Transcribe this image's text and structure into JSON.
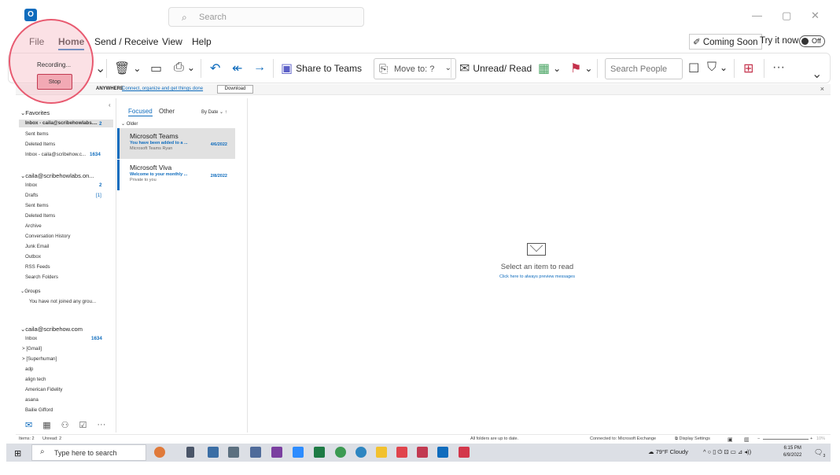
{
  "titlebar": {
    "logo": "O",
    "search_placeholder": "Search",
    "controls": [
      "—",
      "▢",
      "✕"
    ]
  },
  "menu": {
    "tabs": [
      "File",
      "Home",
      "Send / Receive",
      "View",
      "Help"
    ],
    "active": "Home",
    "coming_soon": "Coming Soon",
    "try_it_now": "Try it now",
    "toggle_state": "Off"
  },
  "ribbon": {
    "share_to_teams": "Share to Teams",
    "move_to": "Move to: ?",
    "unread_read": "Unread/ Read",
    "search_people_placeholder": "Search People",
    "more": "···"
  },
  "infobar": {
    "lead": "ANYWHERE",
    "link": "Connect, organize and get things done",
    "download": "Download",
    "close": "×"
  },
  "recording": {
    "status": "Recording...",
    "stop": "Stop"
  },
  "folders": {
    "favorites_header": "Favorites",
    "favorites": [
      {
        "label": "Inbox - caila@scribehowlabs....",
        "count": "2"
      },
      {
        "label": "Sent Items",
        "count": ""
      },
      {
        "label": "Deleted Items",
        "count": ""
      },
      {
        "label": "Inbox - caila@scribehow.c...",
        "count": "1634"
      }
    ],
    "account1_header": "caila@scribehowlabs.on...",
    "account1": [
      {
        "label": "Inbox",
        "count": "2"
      },
      {
        "label": "Drafts",
        "count": "[1]"
      },
      {
        "label": "Sent Items",
        "count": ""
      },
      {
        "label": "Deleted Items",
        "count": ""
      },
      {
        "label": "Archive",
        "count": ""
      },
      {
        "label": "Conversation History",
        "count": ""
      },
      {
        "label": "Junk Email",
        "count": ""
      },
      {
        "label": "Outbox",
        "count": ""
      },
      {
        "label": "RSS Feeds",
        "count": ""
      },
      {
        "label": "Search Folders",
        "count": ""
      }
    ],
    "groups_header": "Groups",
    "groups_note": "You have not joined any grou...",
    "account2_header": "caila@scribehow.com",
    "account2": [
      {
        "label": "Inbox",
        "count": "1634"
      },
      {
        "label": "> [Gmail]",
        "count": ""
      },
      {
        "label": "> [Superhuman]",
        "count": ""
      },
      {
        "label": "adp",
        "count": ""
      },
      {
        "label": "align tech",
        "count": ""
      },
      {
        "label": "American Fidelity",
        "count": ""
      },
      {
        "label": "asana",
        "count": ""
      },
      {
        "label": "Bailie Gifford",
        "count": ""
      }
    ]
  },
  "messages": {
    "tab_focused": "Focused",
    "tab_other": "Other",
    "sort": "By Date ⌄  ↑",
    "group": "⌄  Older",
    "items": [
      {
        "from": "Microsoft Teams",
        "subject": "You have been added to a ...",
        "preview": "Microsoft Teams    Ryan",
        "date": "4/6/2022"
      },
      {
        "from": "Microsoft Viva",
        "subject": "Welcome to your monthly ...",
        "preview": "Private to you",
        "date": "2/8/2022"
      }
    ]
  },
  "reading": {
    "title": "Select an item to read",
    "link": "Click here to always preview messages"
  },
  "status": {
    "items": "Items: 2",
    "unread": "Unread: 2",
    "folders_uptodate": "All folders are up to date.",
    "connected": "Connected to: Microsoft Exchange",
    "display_settings": "Display Settings",
    "zoom": "10%"
  },
  "taskbar": {
    "search_placeholder": "Type here to search",
    "weather": "79°F  Cloudy",
    "time": "6:15 PM",
    "date": "6/9/2022",
    "notif_count": "3"
  },
  "colors": {
    "accent": "#0f6cbd",
    "recording_fill": "#f7bcc6",
    "recording_border": "#e85a70"
  }
}
